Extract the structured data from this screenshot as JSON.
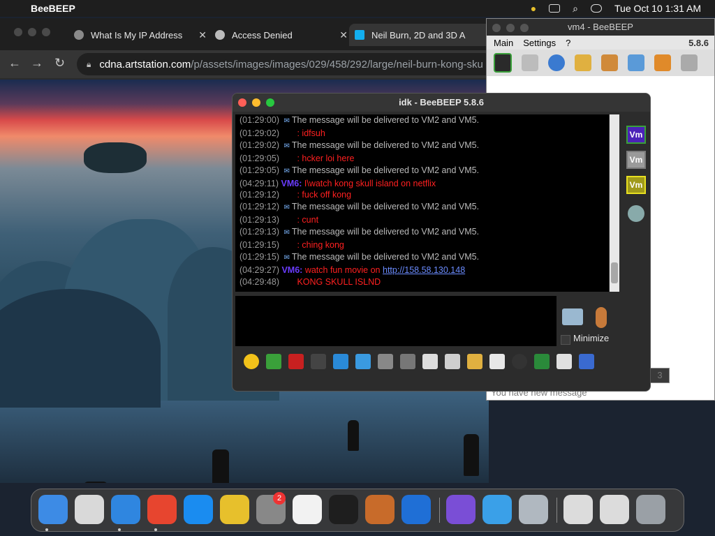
{
  "menubar": {
    "app_name": "BeeBEEP",
    "clock": "Tue Oct 10  1:31 AM"
  },
  "browser": {
    "tabs": [
      {
        "label": "What Is My IP Address",
        "icon": "globe-icon"
      },
      {
        "label": "Access Denied",
        "icon": "shield-icon"
      },
      {
        "label": "Neil Burn, 2D and 3D A",
        "icon": "artstation-icon"
      }
    ],
    "url_host": "cdna.artstation.com",
    "url_path": "/p/assets/images/images/029/458/292/large/neil-burn-kong-sku"
  },
  "vm4": {
    "title": "vm4 - BeeBEEP",
    "menu": [
      "Main",
      "Settings",
      "?"
    ],
    "version": "5.8.6",
    "count": "3",
    "status": "You have new message"
  },
  "chat": {
    "title": "idk - BeeBEEP 5.8.6",
    "messages": [
      {
        "ts": "(01:29:00)",
        "kind": "system",
        "text": "The message will be delivered to VM2 and VM5."
      },
      {
        "ts": "(01:29:02)",
        "kind": "self",
        "text": ": idfsuh"
      },
      {
        "ts": "(01:29:02)",
        "kind": "system",
        "text": "The message will be delivered to VM2 and VM5."
      },
      {
        "ts": "(01:29:05)",
        "kind": "self",
        "text": ": hcker loi here"
      },
      {
        "ts": "(01:29:05)",
        "kind": "system",
        "text": "The message will be delivered to VM2 and VM5."
      },
      {
        "ts": "(04:29:11)",
        "kind": "vm",
        "sender": "VM6:",
        "text": "I\\watch kong skull island on netflix"
      },
      {
        "ts": "(01:29:12)",
        "kind": "self",
        "text": ": fuck off kong"
      },
      {
        "ts": "(01:29:12)",
        "kind": "system",
        "text": "The message will be delivered to VM2 and VM5."
      },
      {
        "ts": "(01:29:13)",
        "kind": "self",
        "text": ": cunt"
      },
      {
        "ts": "(01:29:13)",
        "kind": "system",
        "text": "The message will be delivered to VM2 and VM5."
      },
      {
        "ts": "(01:29:15)",
        "kind": "self",
        "text": ": ching kong"
      },
      {
        "ts": "(01:29:15)",
        "kind": "system",
        "text": "The message will be delivered to VM2 and VM5."
      },
      {
        "ts": "(04:29:27)",
        "kind": "vm-link",
        "sender": "VM6:",
        "text": "watch fun movie on",
        "link": "http://158.58.130.148"
      },
      {
        "ts": "(04:29:48)",
        "kind": "self",
        "text": "KONG SKULL ISLND"
      }
    ],
    "users": [
      {
        "label": "Vm",
        "color": "#4b22b8",
        "border": "#3aa03a"
      },
      {
        "label": "Vm",
        "color": "#9a9a9a",
        "border": "#7a7a7a"
      },
      {
        "label": "Vm",
        "color": "#a09a1a",
        "border": "#e8e020"
      }
    ],
    "minimize_label": "Minimize"
  },
  "dock": {
    "settings_badge": "2",
    "items": [
      {
        "name": "finder-icon",
        "color": "#3d8be5"
      },
      {
        "name": "launchpad-icon",
        "color": "#d9d9d9"
      },
      {
        "name": "safari-icon",
        "color": "#2f86e0"
      },
      {
        "name": "chrome-icon",
        "color": "#e7452f"
      },
      {
        "name": "app-store-icon",
        "color": "#1a8cf0"
      },
      {
        "name": "beebeep-icon",
        "color": "#e7c02c"
      },
      {
        "name": "system-settings-icon",
        "color": "#888888"
      },
      {
        "name": "textedit-icon",
        "color": "#f2f2f2"
      },
      {
        "name": "terminal-icon",
        "color": "#1e1e1e"
      },
      {
        "name": "garageband-icon",
        "color": "#c86b2a"
      },
      {
        "name": "vscode-icon",
        "color": "#1f6fd6"
      },
      {
        "name": "visual-studio-icon",
        "color": "#7a4ed6"
      },
      {
        "name": "weather-icon",
        "color": "#3aa0e8"
      },
      {
        "name": "preview-icon",
        "color": "#b0b8c0"
      },
      {
        "name": "window-thumb-icon",
        "color": "#dcdcdc"
      },
      {
        "name": "window-thumb-icon",
        "color": "#dcdcdc"
      },
      {
        "name": "trash-icon",
        "color": "#9aa0a6"
      }
    ]
  }
}
